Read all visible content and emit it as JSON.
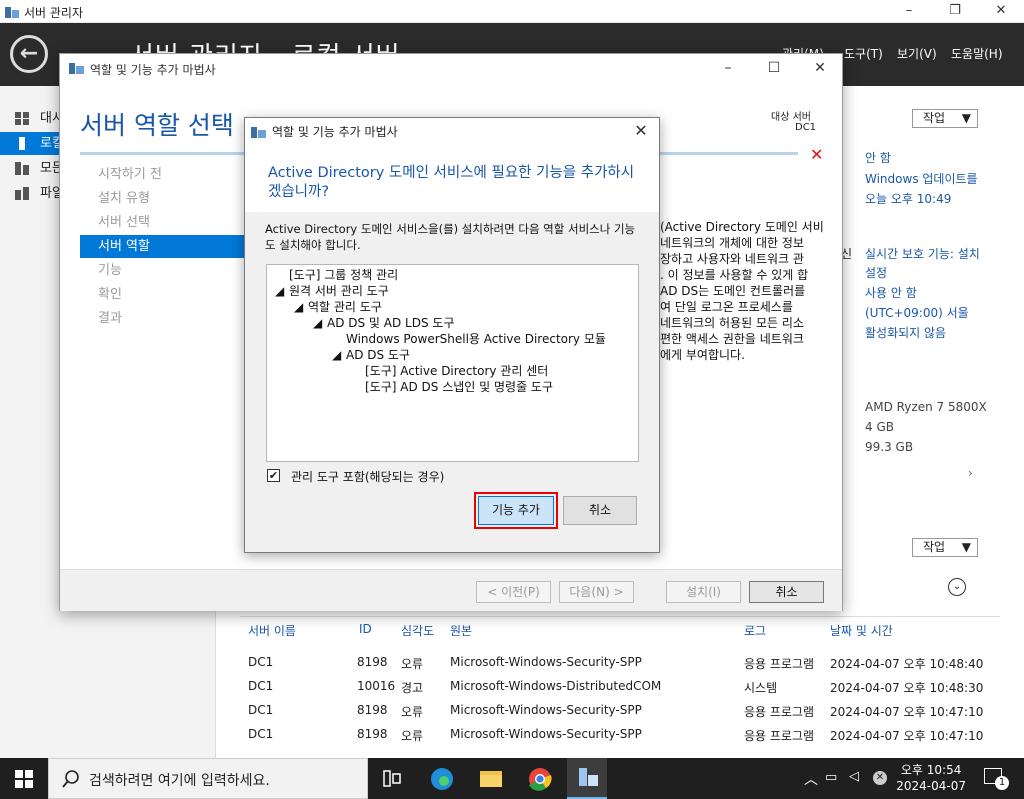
{
  "os_window": {
    "title": "서버 관리자",
    "min": "–",
    "restore": "❐",
    "close": "✕"
  },
  "sm_header": {
    "breadcrumb": "서버 관리자 · 로컬 서버",
    "menus": [
      "관리(M)",
      "도구(T)",
      "보기(V)",
      "도움말(H)"
    ]
  },
  "nav": {
    "items": [
      "대시보드",
      "로컬 서버",
      "모든 서버",
      "파일 및 저장소 서비스"
    ]
  },
  "right_panel": {
    "work_label": "작업",
    "lines": [
      "안 함",
      "Windows 업데이트를",
      "오늘 오후 10:49",
      "실시간 보호 기능: 설치",
      "설정",
      "사용 안 함",
      "(UTC+09:00) 서울",
      "활성화되지 않음",
      "AMD Ryzen 7 5800X",
      "4 GB",
      "99.3 GB"
    ],
    "side_label": "신"
  },
  "events": {
    "work_label": "작업",
    "columns": [
      "서버 이름",
      "ID",
      "심각도",
      "원본",
      "로그",
      "날짜 및 시간"
    ],
    "rows": [
      [
        "DC1",
        "8198",
        "오류",
        "Microsoft-Windows-Security-SPP",
        "응용 프로그램",
        "2024-04-07 오후 10:48:40"
      ],
      [
        "DC1",
        "10016",
        "경고",
        "Microsoft-Windows-DistributedCOM",
        "시스템",
        "2024-04-07 오후 10:48:30"
      ],
      [
        "DC1",
        "8198",
        "오류",
        "Microsoft-Windows-Security-SPP",
        "응용 프로그램",
        "2024-04-07 오후 10:47:10"
      ],
      [
        "DC1",
        "8198",
        "오류",
        "Microsoft-Windows-Security-SPP",
        "응용 프로그램",
        "2024-04-07 오후 10:47:10"
      ]
    ]
  },
  "wizard": {
    "title": "역할 및 기능 추가 마법사",
    "heading": "서버 역할 선택",
    "target_label": "대상 서버",
    "target_value": "DC1",
    "steps": [
      "시작하기 전",
      "설치 유형",
      "서버 선택",
      "서버 역할",
      "기능",
      "확인",
      "결과"
    ],
    "desc_lines": [
      "(Active Directory 도메인 서비",
      "네트워크의 개체에 대한 정보",
      "장하고 사용자와 네트워크 관",
      ". 이 정보를 사용할 수 있게 합",
      "AD DS는 도메인 컨트롤러를",
      "여 단일 로그온 프로세스를",
      "네트워크의 허용된 모든 리소",
      "편한 액세스 권한을 네트워크",
      "에게 부여합니다."
    ],
    "buttons": {
      "prev": "< 이전(P)",
      "next": "다음(N) >",
      "install": "설치(I)",
      "cancel": "취소"
    }
  },
  "dialog": {
    "title": "역할 및 기능 추가 마법사",
    "heading": "Active Directory 도메인 서비스에 필요한 기능을 추가하시겠습니까?",
    "description": "Active Directory 도메인 서비스을(를) 설치하려면 다음 역할 서비스나 기능도 설치해야 합니다.",
    "tree": [
      "[도구] 그룹 정책 관리",
      "원격 서버 관리 도구",
      "역할 관리 도구",
      "AD DS 및 AD LDS 도구",
      "Windows PowerShell용 Active Directory 모듈",
      "AD DS 도구",
      "[도구] Active Directory 관리 센터",
      "[도구] AD DS 스냅인 및 명령줄 도구"
    ],
    "checkbox_label": "관리 도구 포함(해당되는 경우)",
    "add_button": "기능 추가",
    "cancel_button": "취소"
  },
  "taskbar": {
    "search_placeholder": "검색하려면 여기에 입력하세요.",
    "time": "오후 10:54",
    "date": "2024-04-07",
    "notif_count": "1"
  }
}
